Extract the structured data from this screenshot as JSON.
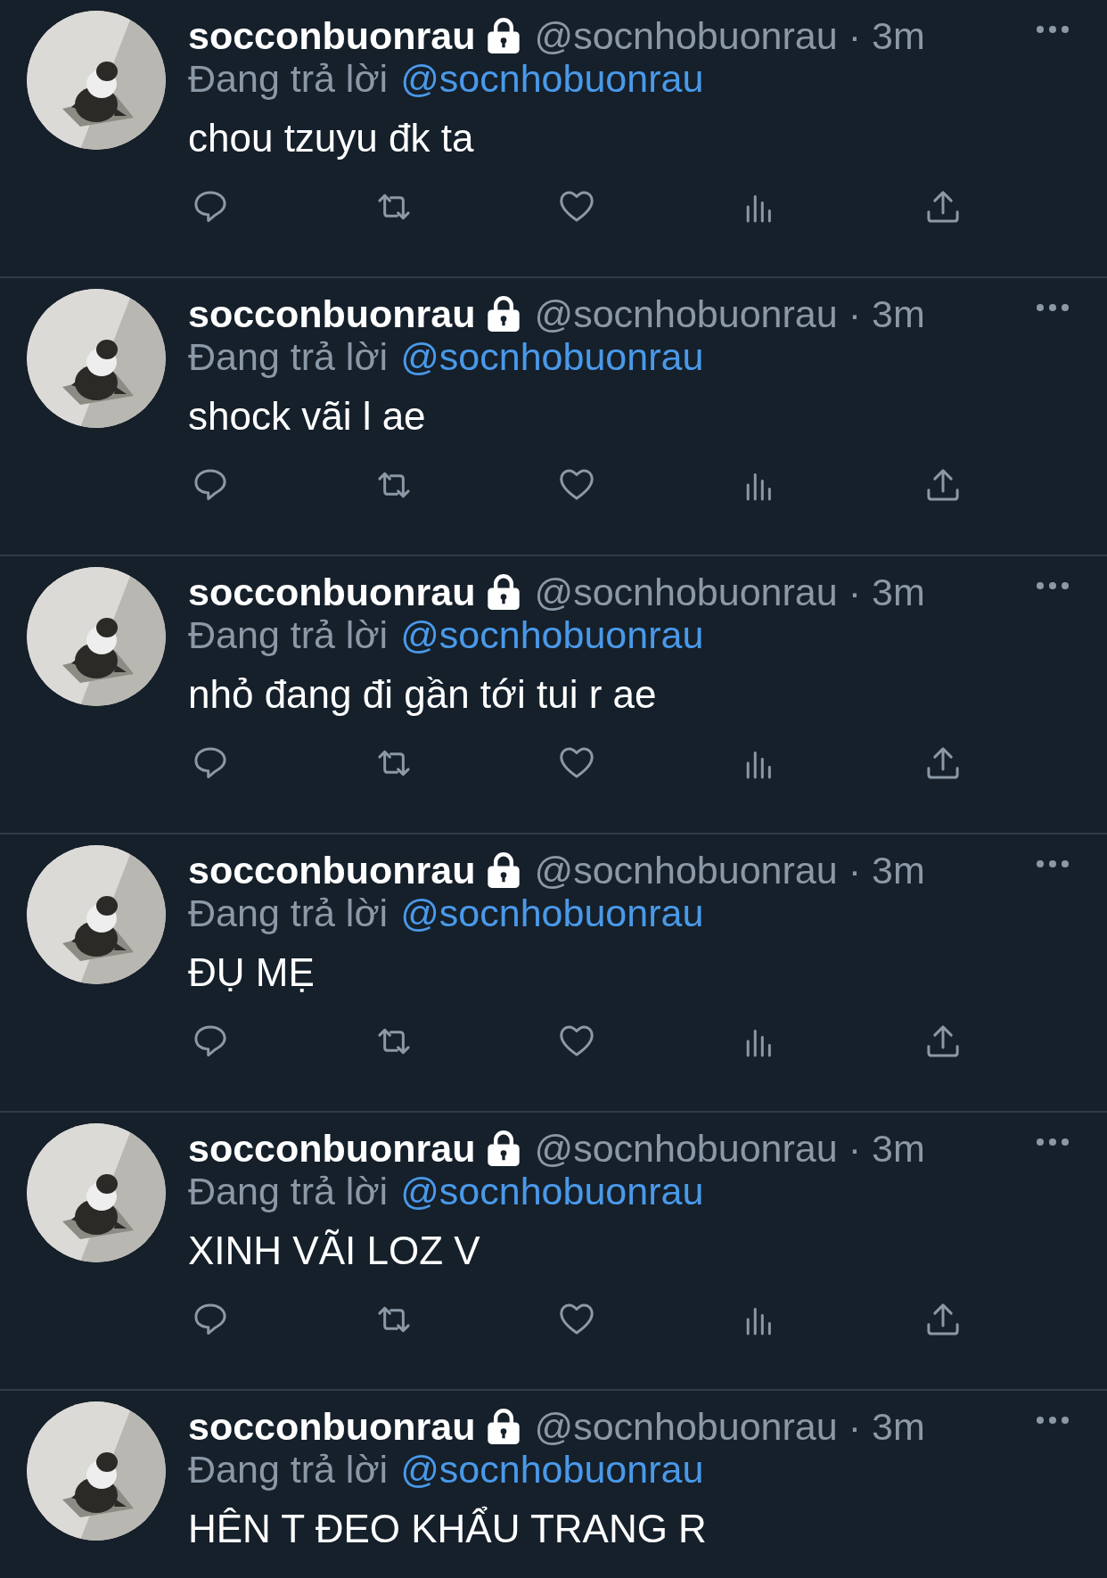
{
  "tweets": [
    {
      "name": "socconbuonrau",
      "handle": "@socnhobuonrau",
      "separator": "·",
      "time": "3m",
      "reply_label": "Đang trả lời",
      "reply_to": "@socnhobuonrau",
      "text": "chou tzuyu đk ta",
      "actions": true
    },
    {
      "name": "socconbuonrau",
      "handle": "@socnhobuonrau",
      "separator": "·",
      "time": "3m",
      "reply_label": "Đang trả lời",
      "reply_to": "@socnhobuonrau",
      "text": "shock vãi l ae",
      "actions": true
    },
    {
      "name": "socconbuonrau",
      "handle": "@socnhobuonrau",
      "separator": "·",
      "time": "3m",
      "reply_label": "Đang trả lời",
      "reply_to": "@socnhobuonrau",
      "text": "nhỏ đang đi gần tới tui r ae",
      "actions": true
    },
    {
      "name": "socconbuonrau",
      "handle": "@socnhobuonrau",
      "separator": "·",
      "time": "3m",
      "reply_label": "Đang trả lời",
      "reply_to": "@socnhobuonrau",
      "text": "ĐỤ MẸ",
      "actions": true
    },
    {
      "name": "socconbuonrau",
      "handle": "@socnhobuonrau",
      "separator": "·",
      "time": "3m",
      "reply_label": "Đang trả lời",
      "reply_to": "@socnhobuonrau",
      "text": "XINH VÃI LOZ V",
      "actions": true
    },
    {
      "name": "socconbuonrau",
      "handle": "@socnhobuonrau",
      "separator": "·",
      "time": "3m",
      "reply_label": "Đang trả lời",
      "reply_to": "@socnhobuonrau",
      "text": "HÊN T ĐEO KHẨU TRANG R",
      "actions": false
    }
  ]
}
